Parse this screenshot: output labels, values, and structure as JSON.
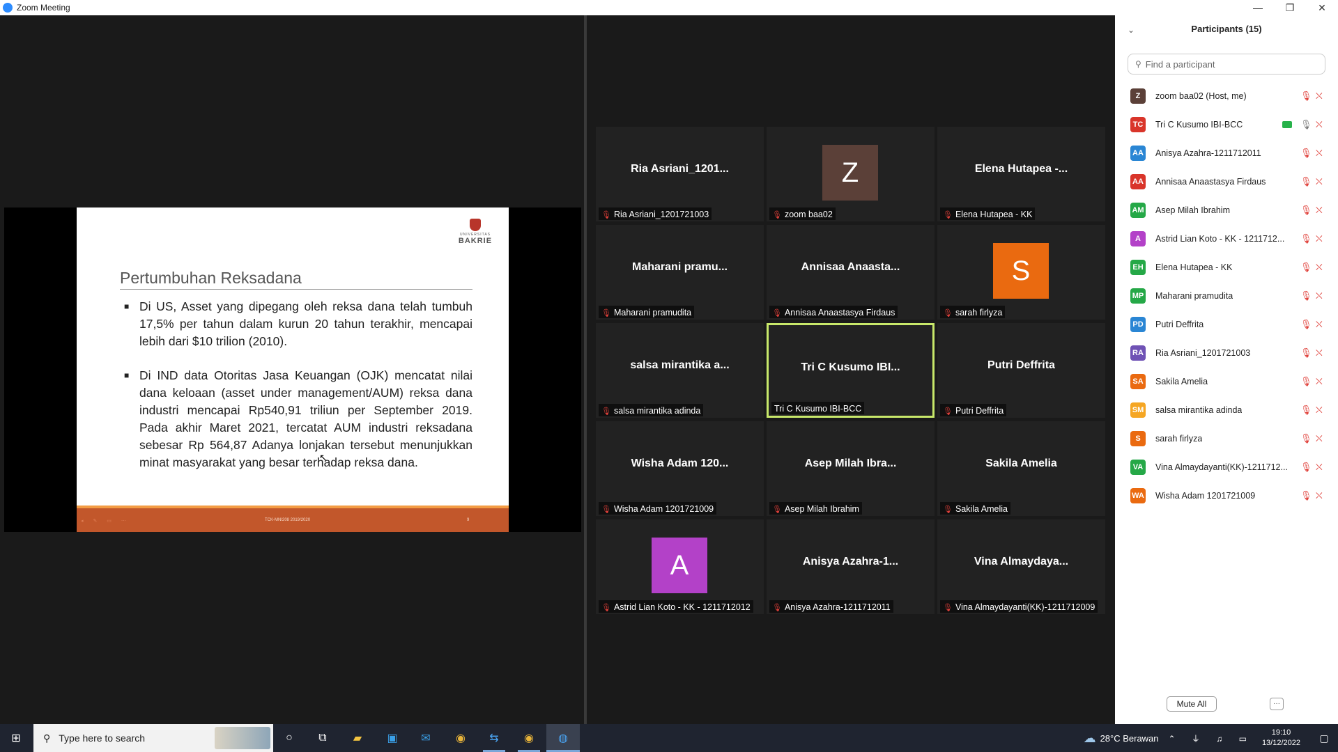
{
  "window": {
    "title": "Zoom Meeting",
    "controls": [
      "—",
      "❐",
      "✕"
    ]
  },
  "slide": {
    "logo_small": "UNIVERSITAS",
    "logo_big": "BAKRIE",
    "title": "Pertumbuhan Reksadana",
    "bullets": [
      "Di US, Asset yang dipegang oleh reksa dana telah tumbuh 17,5% per tahun  dalam kurun 20 tahun terakhir, mencapai lebih dari $10 trilion (2010).",
      "Di IND data Otoritas Jasa Keuangan (OJK) mencatat nilai dana keloaan (asset under management/AUM) reksa dana industri mencapai Rp540,91 triliun per September 2019. Pada akhir Maret 2021, tercatat AUM industri reksadana sebesar Rp 564,87 Adanya lonjakan tersebut menunjukkan minat masyarakat yang besar terhadap reksa dana."
    ],
    "footer_text": "TCK-MNI208 2019/2020",
    "page_number": "9"
  },
  "gallery": {
    "tiles": [
      {
        "big": "Ria  Asriani_1201...",
        "label": "Ria Asriani_1201721003"
      },
      {
        "big": "",
        "label": "zoom baa02",
        "avatar": "Z",
        "avatar_color": "#5b4038"
      },
      {
        "big": "Elena Hutapea -...",
        "label": "Elena Hutapea - KK"
      },
      {
        "big": "Maharani  pramu...",
        "label": "Maharani pramudita"
      },
      {
        "big": "Annisaa  Anaasta...",
        "label": "Annisaa Anaastasya Firdaus"
      },
      {
        "big": "",
        "label": "sarah firlyza",
        "avatar": "S",
        "avatar_color": "#ea6a10"
      },
      {
        "big": "salsa  mirantika  a...",
        "label": "salsa mirantika adinda"
      },
      {
        "big": "Tri  C  Kusumo  IBI...",
        "label": "Tri C Kusumo IBI-BCC",
        "active": true
      },
      {
        "big": "Putri  Deffrita",
        "label": "Putri Deffrita"
      },
      {
        "big": "Wisha  Adam  120...",
        "label": "Wisha Adam 1201721009"
      },
      {
        "big": "Asep  Milah  Ibra...",
        "label": "Asep Milah Ibrahim"
      },
      {
        "big": "Sakila  Amelia",
        "label": "Sakila Amelia"
      },
      {
        "big": "",
        "label": "Astrid Lian Koto - KK - 1211712012",
        "avatar": "A",
        "avatar_color": "#b341c8"
      },
      {
        "big": "Anisya  Azahra-1...",
        "label": "Anisya Azahra-1211712011"
      },
      {
        "big": "Vina  Almaydaya...",
        "label": "Vina Almaydayanti(KK)-1211712009"
      }
    ]
  },
  "participants": {
    "header": "Participants (15)",
    "search_placeholder": "Find a participant",
    "list": [
      {
        "initials": "Z",
        "color": "#5b4038",
        "name": "zoom baa02 (Host, me)"
      },
      {
        "initials": "TC",
        "color": "#d9352a",
        "name": "Tri C Kusumo IBI-BCC",
        "sharing": true,
        "mic_on": true
      },
      {
        "initials": "AA",
        "color": "#2a86d4",
        "name": "Anisya Azahra-1211712011"
      },
      {
        "initials": "AA",
        "color": "#d9352a",
        "name": "Annisaa Anaastasya Firdaus"
      },
      {
        "initials": "AM",
        "color": "#25a847",
        "name": "Asep Milah Ibrahim"
      },
      {
        "initials": "A",
        "color": "#b341c8",
        "name": "Astrid Lian Koto - KK - 1211712..."
      },
      {
        "initials": "EH",
        "color": "#25a847",
        "name": "Elena Hutapea - KK"
      },
      {
        "initials": "MP",
        "color": "#25a847",
        "name": "Maharani pramudita"
      },
      {
        "initials": "PD",
        "color": "#2a86d4",
        "name": "Putri Deffrita"
      },
      {
        "initials": "RA",
        "color": "#6f52b5",
        "name": "Ria Asriani_1201721003"
      },
      {
        "initials": "SA",
        "color": "#ea6a10",
        "name": "Sakila Amelia"
      },
      {
        "initials": "SM",
        "color": "#f5a623",
        "name": "salsa mirantika adinda"
      },
      {
        "initials": "S",
        "color": "#ea6a10",
        "name": "sarah firlyza"
      },
      {
        "initials": "VA",
        "color": "#25a847",
        "name": "Vina Almaydayanti(KK)-1211712..."
      },
      {
        "initials": "WA",
        "color": "#ea6a10",
        "name": "Wisha Adam 1201721009"
      }
    ],
    "mute_all": "Mute All",
    "more": "···"
  },
  "taskbar": {
    "search_placeholder": "Type here to search",
    "weather": "28°C  Berawan",
    "time": "19:10",
    "date": "13/12/2022"
  }
}
